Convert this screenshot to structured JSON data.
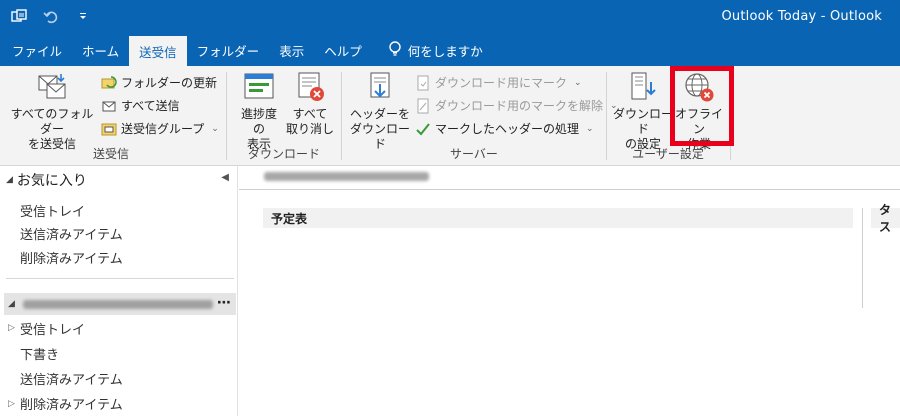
{
  "window": {
    "title": "Outlook Today  -  Outlook"
  },
  "qat": {
    "items": [
      "send-receive-icon",
      "undo-icon",
      "customize-icon"
    ]
  },
  "menu": {
    "tabs": [
      {
        "label": "ファイル",
        "active": false
      },
      {
        "label": "ホーム",
        "active": false
      },
      {
        "label": "送受信",
        "active": true
      },
      {
        "label": "フォルダー",
        "active": false
      },
      {
        "label": "表示",
        "active": false
      },
      {
        "label": "ヘルプ",
        "active": false
      }
    ],
    "tell_me": "何をしますか"
  },
  "ribbon": {
    "send_receive": {
      "label": "送受信",
      "all_folders": "すべてのフォルダー\nを送受信",
      "update_folder": "フォルダーの更新",
      "send_all": "すべて送信",
      "groups": "送受信グループ"
    },
    "download": {
      "label": "ダウンロード",
      "show_progress": "進捗度の\n表示",
      "cancel_all": "すべて\n取り消し"
    },
    "server": {
      "label": "サーバー",
      "download_headers": "ヘッダーを\nダウンロード",
      "mark_download": "ダウンロード用にマーク",
      "unmark_download": "ダウンロード用のマークを解除",
      "process_marked": "マークしたヘッダーの処理"
    },
    "preferences": {
      "label": "ユーザー設定",
      "download_prefs": "ダウンロード\nの設定",
      "work_offline": "オフライン\n作業"
    }
  },
  "nav": {
    "favorites_label": "お気に入り",
    "favorites": [
      "受信トレイ",
      "送信済みアイテム",
      "削除済みアイテム"
    ],
    "account_items": [
      "受信トレイ",
      "下書き",
      "送信済みアイテム",
      "削除済みアイテム"
    ]
  },
  "main": {
    "calendar_header": "予定表",
    "tasks_header": "タス"
  },
  "colors": {
    "brand": "#0a64b4",
    "highlight": "#e8001c",
    "ribbon_bg": "#f3f3f3"
  }
}
